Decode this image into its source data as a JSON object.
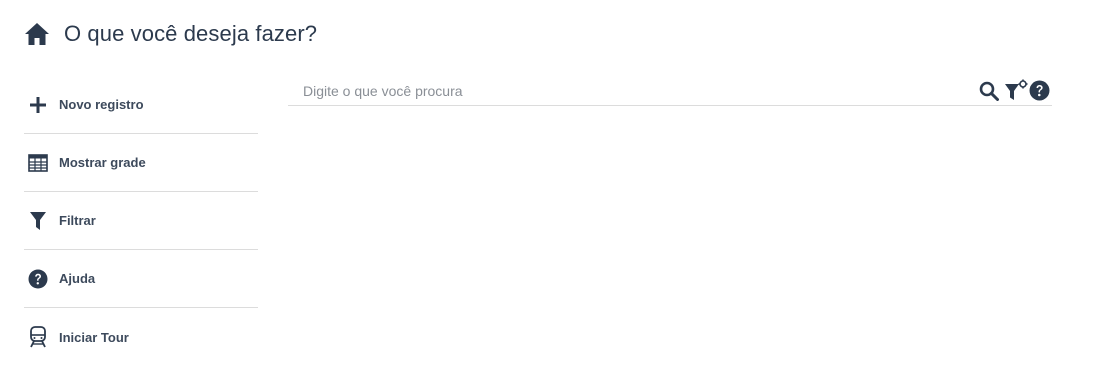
{
  "header": {
    "icon": "home-icon",
    "title": "O que você deseja fazer?"
  },
  "sidebar": {
    "items": [
      {
        "icon": "plus-icon",
        "label": "Novo registro"
      },
      {
        "icon": "table-grid-icon",
        "label": "Mostrar grade"
      },
      {
        "icon": "filter-icon",
        "label": "Filtrar"
      },
      {
        "icon": "question-circle-icon",
        "label": "Ajuda"
      },
      {
        "icon": "train-icon",
        "label": "Iniciar Tour"
      }
    ]
  },
  "search": {
    "placeholder": "Digite o que você procura",
    "value": "",
    "actions": [
      "search-icon",
      "filter-settings-icon",
      "help-icon"
    ]
  },
  "colors": {
    "text_dark": "#2c3a4d",
    "divider": "#dcdcdc",
    "placeholder": "#8a8f96"
  }
}
